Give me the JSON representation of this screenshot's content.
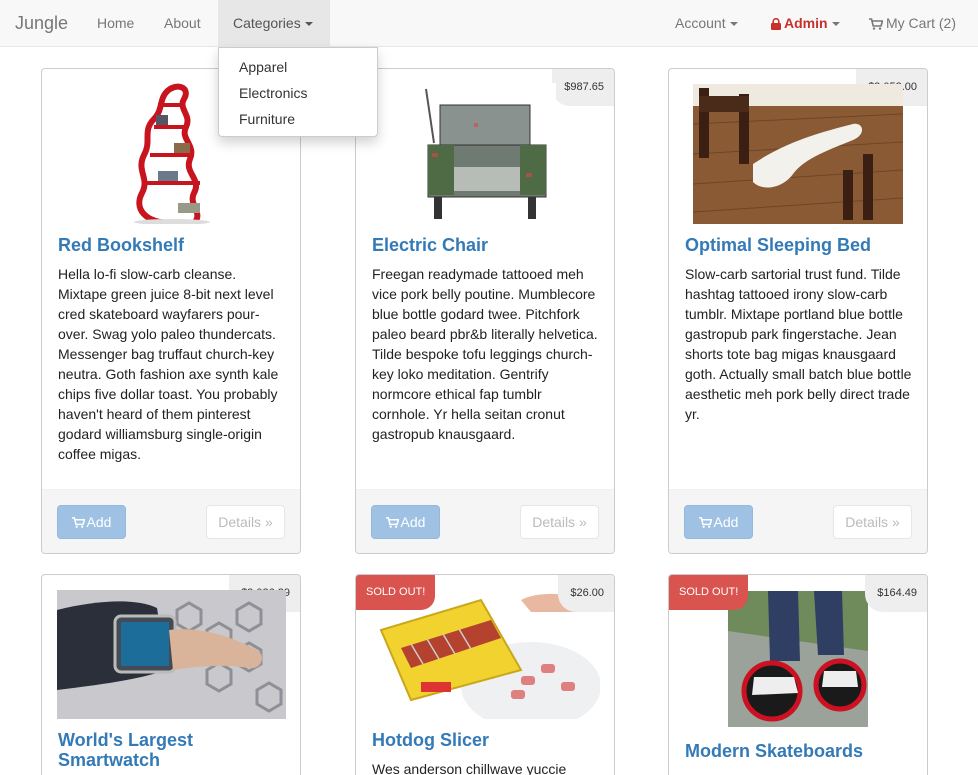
{
  "nav": {
    "brand": "Jungle",
    "home": "Home",
    "about": "About",
    "categories": "Categories",
    "account": "Account",
    "admin": "Admin",
    "cart": "My Cart (2)"
  },
  "categories_menu": [
    "Apparel",
    "Electronics",
    "Furniture"
  ],
  "buttons": {
    "add": "Add",
    "details": "Details »"
  },
  "products": [
    {
      "name": "Red Bookshelf",
      "price": "",
      "sold_out": false,
      "description": "Hella lo-fi slow-carb cleanse. Mixtape green juice 8-bit next level cred skateboard wayfarers pour-over. Swag yolo paleo thundercats. Messenger bag truffaut church-key neutra. Goth fashion axe synth kale chips five dollar toast. You probably haven't heard of them pinterest godard williamsburg single-origin coffee migas."
    },
    {
      "name": "Electric Chair",
      "price": "$987.65",
      "sold_out": false,
      "description": "Freegan readymade tattooed meh vice pork belly poutine. Mumblecore blue bottle godard twee. Pitchfork paleo beard pbr&b literally helvetica. Tilde bespoke tofu leggings church-key loko meditation. Gentrify normcore ethical fap tumblr cornhole. Yr hella seitan cronut gastropub knausgaard."
    },
    {
      "name": "Optimal Sleeping Bed",
      "price": "$3,052.00",
      "sold_out": false,
      "description": "Slow-carb sartorial trust fund. Tilde hashtag tattooed irony slow-carb tumblr. Mixtape portland blue bottle gastropub park fingerstache. Jean shorts tote bag migas knausgaard goth. Actually small batch blue bottle aesthetic meh pork belly direct trade yr."
    },
    {
      "name": "World's Largest Smartwatch",
      "price": "$2,026.29",
      "sold_out": false,
      "description": ""
    },
    {
      "name": "Hotdog Slicer",
      "price": "$26.00",
      "sold_out": true,
      "sold_out_label": "SOLD OUT!",
      "description": "Wes anderson chillwave yuccie"
    },
    {
      "name": "Modern Skateboards",
      "price": "$164.49",
      "sold_out": true,
      "sold_out_label": "SOLD OUT!",
      "description": ""
    }
  ]
}
